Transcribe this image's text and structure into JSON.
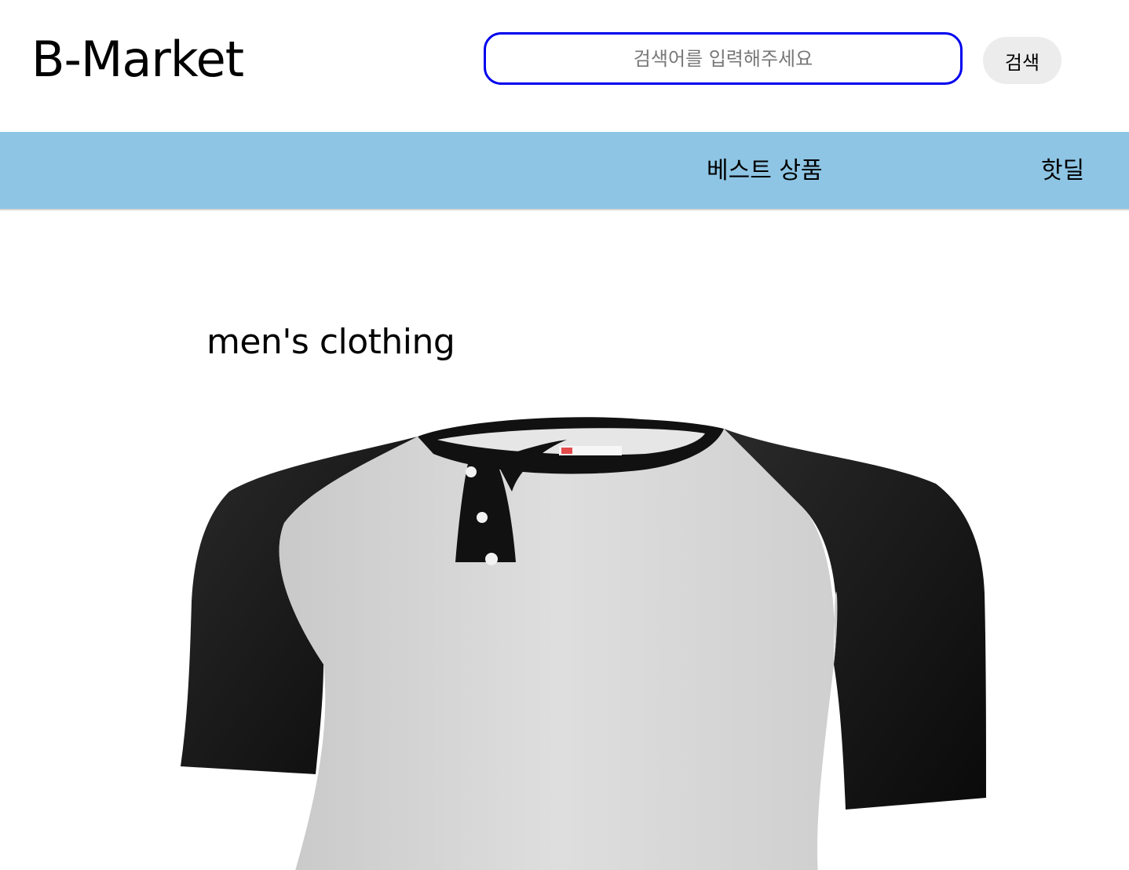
{
  "header": {
    "logo": "B-Market",
    "search": {
      "placeholder": "검색어를 입력해주세요",
      "value": "",
      "button_label": "검색"
    }
  },
  "nav": {
    "items": [
      {
        "label": "베스트 상품"
      },
      {
        "label": "핫딜"
      }
    ]
  },
  "main": {
    "category_title": "men's clothing",
    "product_image": {
      "icon": "raglan-henley-shirt-photo",
      "colors": {
        "body": "#d9d9d9",
        "sleeves": "#111111",
        "placket": "#111111"
      }
    }
  },
  "colors": {
    "nav_background": "#8ec5e4",
    "search_border": "#0000ee",
    "search_button_bg": "#ececec"
  }
}
